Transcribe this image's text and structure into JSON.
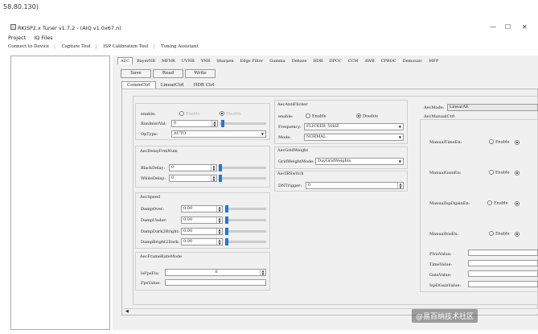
{
  "address": "58.80.130)",
  "window": {
    "title": "RKISP2.x Tuner v1.7.2 - (AIQ v1.0x67.n)",
    "min": "—",
    "max": "☐",
    "close": "✕"
  },
  "menu": [
    "Project",
    "IQ Files"
  ],
  "toolbar": [
    "Connect to Device",
    "Capture Tool",
    "ISP Calibration Tool",
    "Tuning Assistant"
  ],
  "tabs": [
    "AEC",
    "BayerNR",
    "MFNR",
    "UVNR",
    "YNR",
    "Sharpen",
    "Edge Filter",
    "Gamma",
    "Dehaze",
    "HDR",
    "DPCC",
    "CCM",
    "AWB",
    "CPROC",
    "Demosaic",
    "MFP"
  ],
  "buttons": {
    "save": "Save",
    "read": "Read",
    "write": "Write"
  },
  "subtabs": [
    "CommCtrl",
    "LinearCtrl",
    "HDR Ctrl"
  ],
  "left": {
    "enable_label": "enable:",
    "enable_opt": "Enable",
    "disable_opt": "Disable",
    "run_label": "RunInterVal:",
    "run_val": "0",
    "op_label": "OpType:",
    "op_val": "AUTO",
    "delay_title": "AecDelayFrmNum",
    "black_label": "BlackDelay:",
    "black_val": "0",
    "white_label": "WhiteDelay:",
    "white_val": "0",
    "speed_title": "AecSpeed",
    "damp_over_label": "DampOver:",
    "damp_over_val": "0.00",
    "damp_under_label": "DampUnder:",
    "damp_under_val": "0.00",
    "damp_dark_label": "DampDark2Bright:",
    "damp_dark_val": "0.00",
    "damp_bright_label": "DampBright2Dark:",
    "damp_bright_val": "0.00",
    "fr_title": "AecFrameRateMode",
    "isfps_label": "isFpsFix:",
    "isfps_val": "0",
    "fpsval_label": "FpsValue:"
  },
  "mid": {
    "anti_title": "AecAntiFlicker",
    "enable_label": "enable:",
    "enable_opt": "Enable",
    "disable_opt": "Disable",
    "freq_label": "Frequency:",
    "freq_val": "FLICKER_50HZ",
    "mode_label": "Mode:",
    "mode_val": "NORMAL",
    "grid_title": "AecGridWeight",
    "grid_label": "GridWeightMode:",
    "grid_val": "DayGridWeights",
    "ir_title": "AecIRSwitch",
    "dn_label": "DNTrigger:",
    "dn_val": "0"
  },
  "right": {
    "mode_label": "AecMode:",
    "mode_val": "LinearAE",
    "manual_title": "AecManualCtrl",
    "time_label": "ManualTimeEn:",
    "gain_label": "ManualGainEn:",
    "isp_label": "ManualIspDgainEn:",
    "iris_label": "ManualIrisEn:",
    "enable_opt": "Enable",
    "iris_val": "PIrisValue:",
    "time_val": "TimeValue:",
    "gain_val": "GainValue:",
    "isp_val": "IspDGainValue:"
  },
  "watermark": "@易百纳技术社区"
}
